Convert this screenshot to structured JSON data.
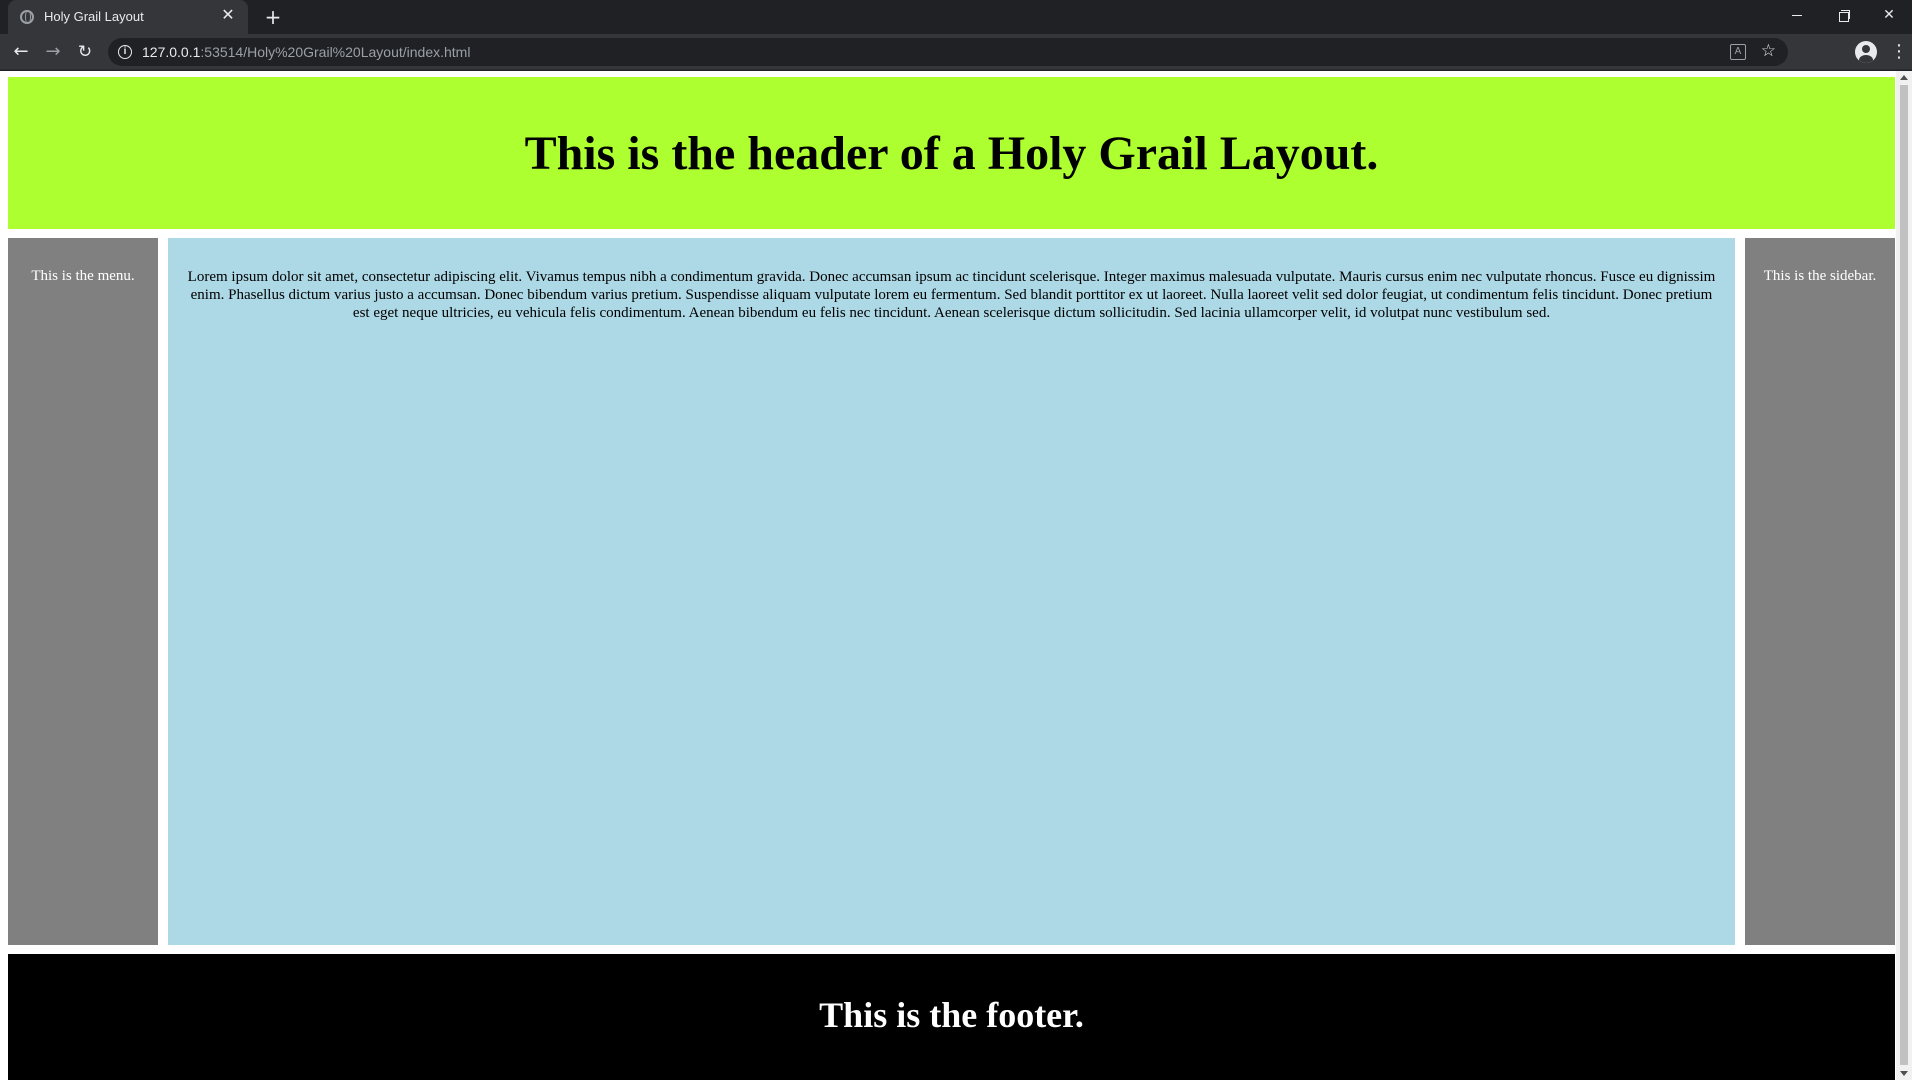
{
  "browser": {
    "tab_title": "Holy Grail Layout",
    "tab_close_glyph": "✕",
    "new_tab_glyph": "+",
    "url_host": "127.0.0.1",
    "url_path": ":53514/Holy%20Grail%20Layout/index.html",
    "icons": {
      "back": "arrow-left-icon",
      "forward": "arrow-right-icon",
      "reload": "reload-icon",
      "info": "info-icon",
      "translate": "translate-icon",
      "bookmark": "star-icon",
      "profile": "profile-icon",
      "menu": "kebab-menu-icon"
    }
  },
  "page": {
    "header": "This is the header of a Holy Grail Layout.",
    "menu": "This is the menu.",
    "main_text": "Lorem ipsum dolor sit amet, consectetur adipiscing elit. Vivamus tempus nibh a condimentum gravida. Donec accumsan ipsum ac tincidunt scelerisque. Integer maximus malesuada vulputate. Mauris cursus enim nec vulputate rhoncus. Fusce eu dignissim enim. Phasellus dictum varius justo a accumsan. Donec bibendum varius pretium. Suspendisse aliquam vulputate lorem eu fermentum. Sed blandit porttitor ex ut laoreet. Nulla laoreet velit sed dolor feugiat, ut condimentum felis tincidunt. Donec pretium est eget neque ultricies, eu vehicula felis condimentum. Aenean bibendum eu felis nec tincidunt. Aenean scelerisque dictum sollicitudin. Sed lacinia ullamcorper velit, id volutpat nunc vestibulum sed.",
    "sidebar": "This is the sidebar.",
    "footer": "This is the footer."
  },
  "colors": {
    "header_bg": "#adff2f",
    "menu_bg": "#808080",
    "main_bg": "#add8e6",
    "sidebar_bg": "#808080",
    "footer_bg": "#000000"
  }
}
